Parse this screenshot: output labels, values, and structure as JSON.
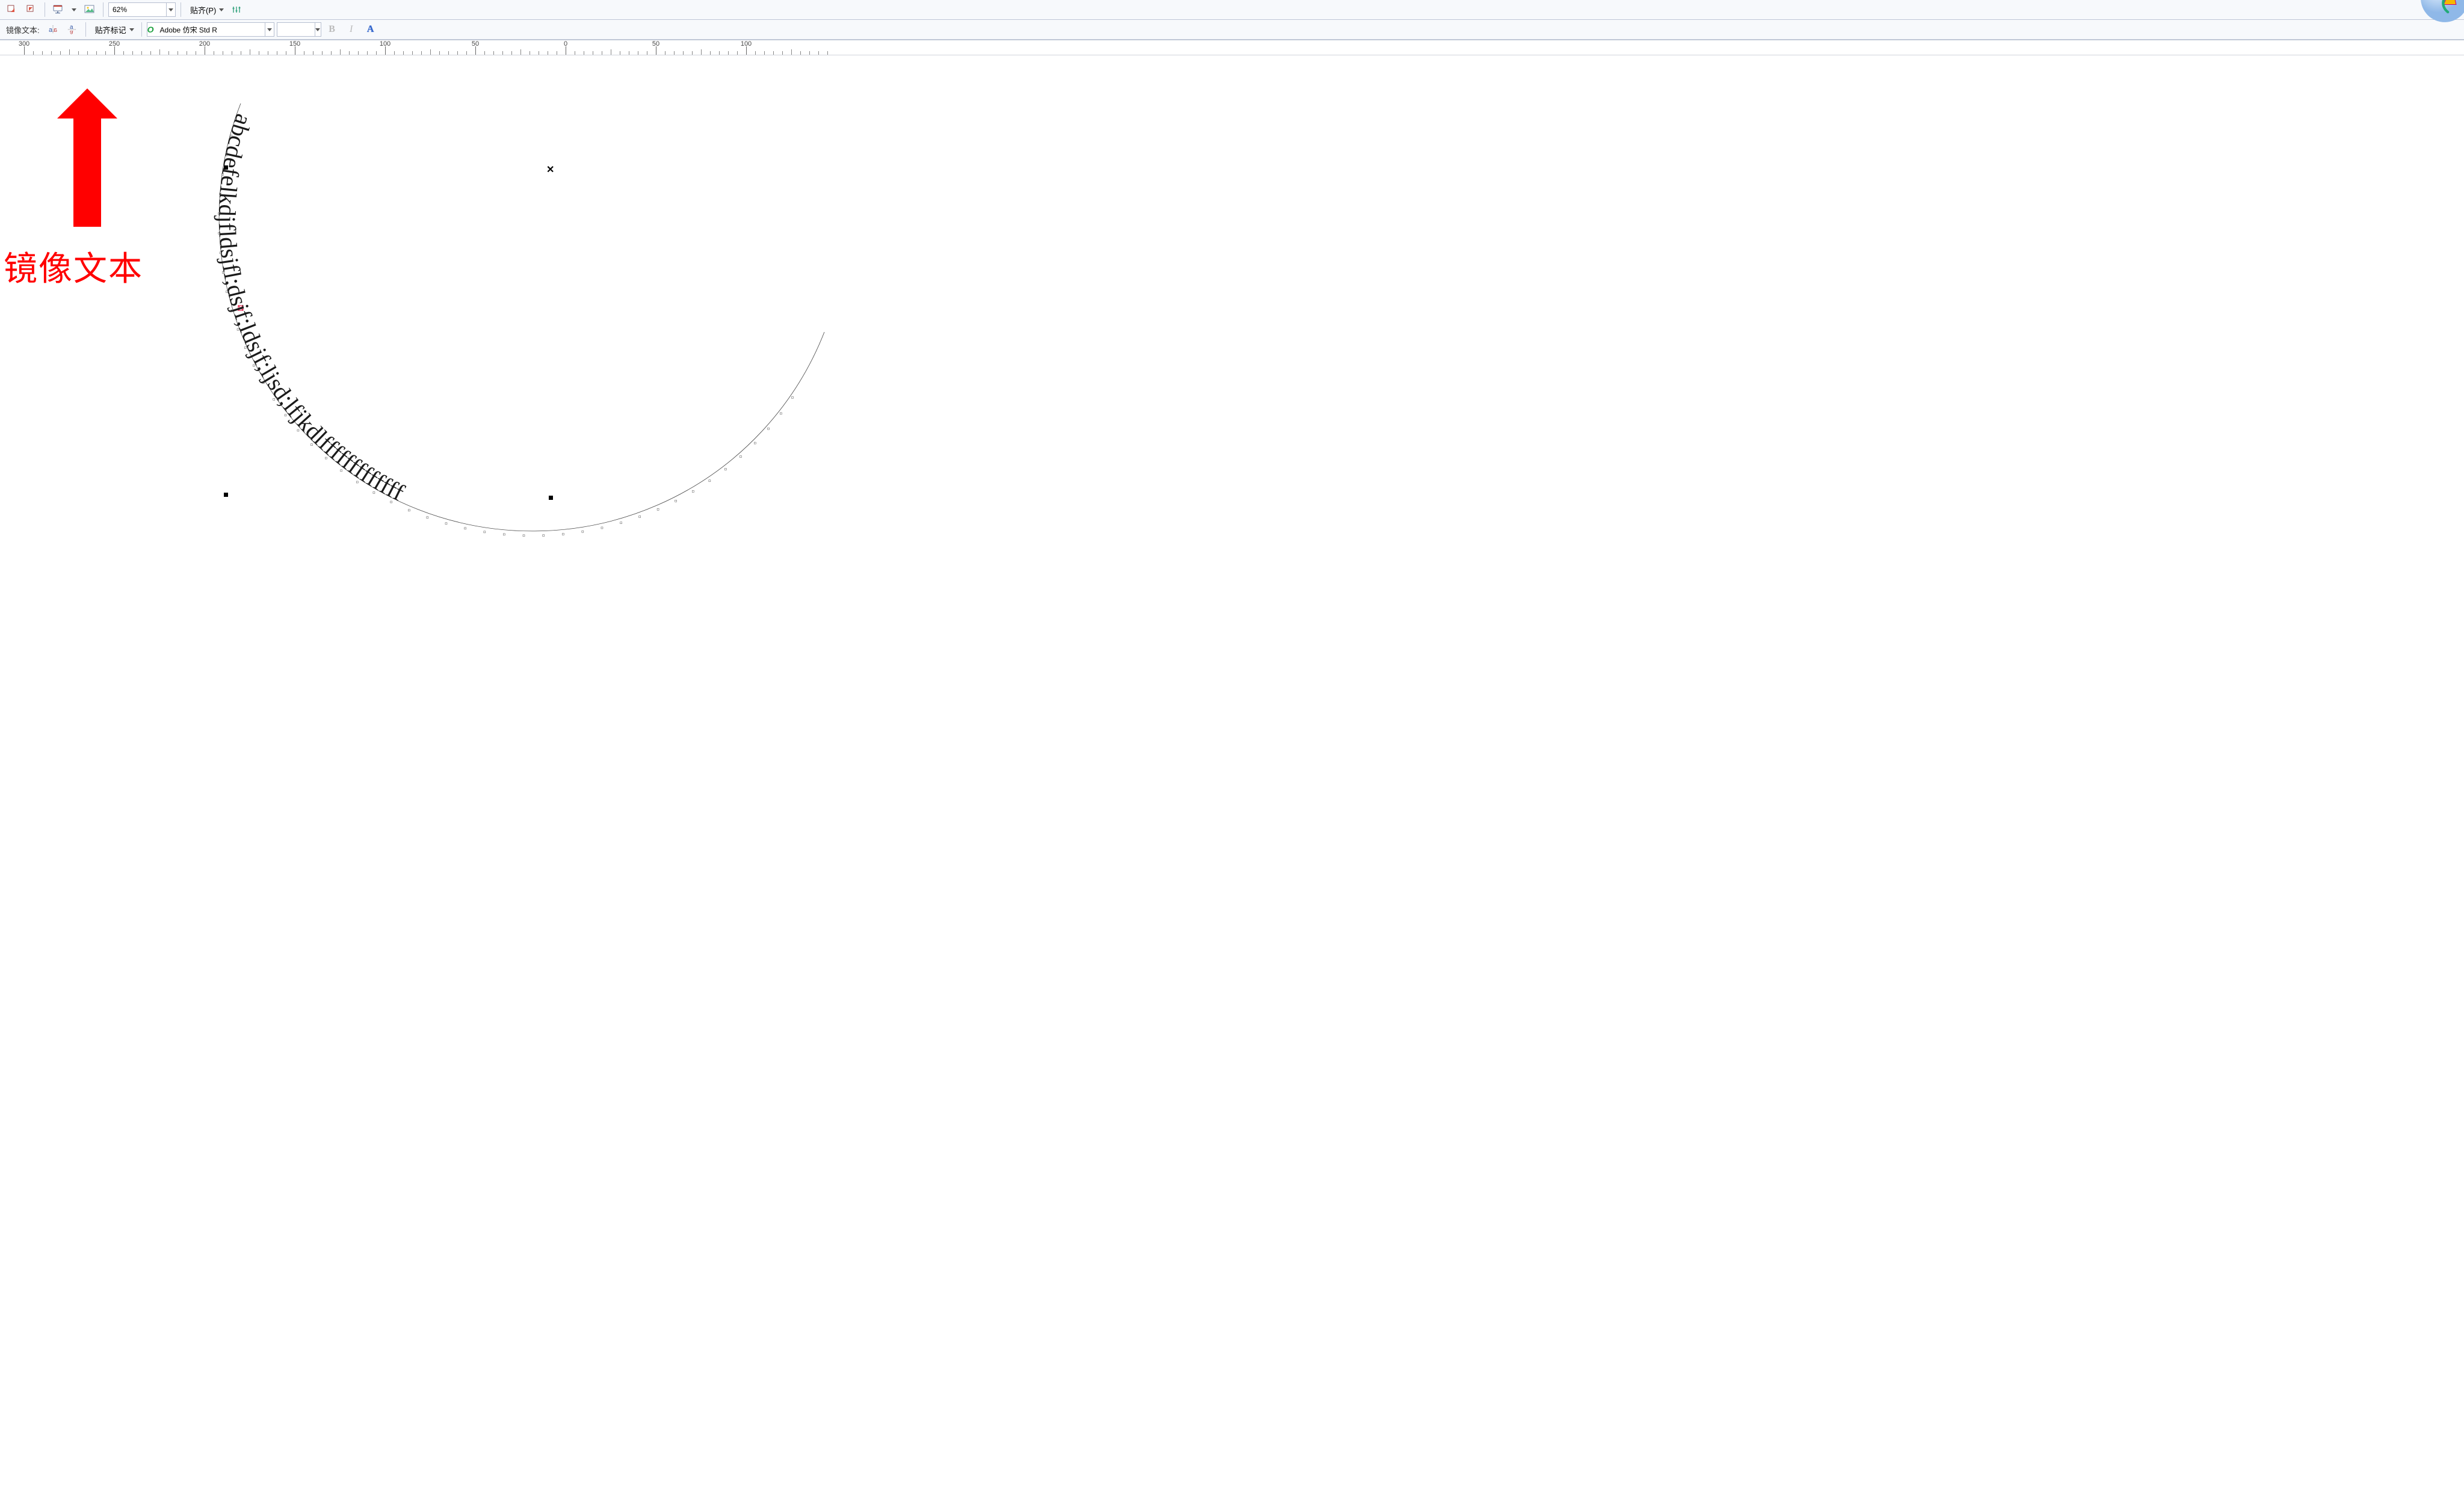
{
  "toolbar1": {
    "zoom": "62%",
    "snap_label": "贴齐(P)"
  },
  "toolbar2": {
    "mirror_text_label": "镜像文本:",
    "snap_marks_label": "贴齐标记",
    "font_name": "Adobe 仿宋 Std R",
    "font_size": "",
    "bold": "B",
    "italic": "I",
    "text_effect": "A"
  },
  "ruler": {
    "labels": [
      "300",
      "250",
      "200",
      "150",
      "100",
      "50",
      "0",
      "50",
      "100"
    ]
  },
  "annotation": {
    "label": "镜像文本"
  },
  "path_text": {
    "content": "abcdefelkdjfldsjfl;dsjf;ldsjf;ljsd;lfjkdlfffffffffffff"
  }
}
